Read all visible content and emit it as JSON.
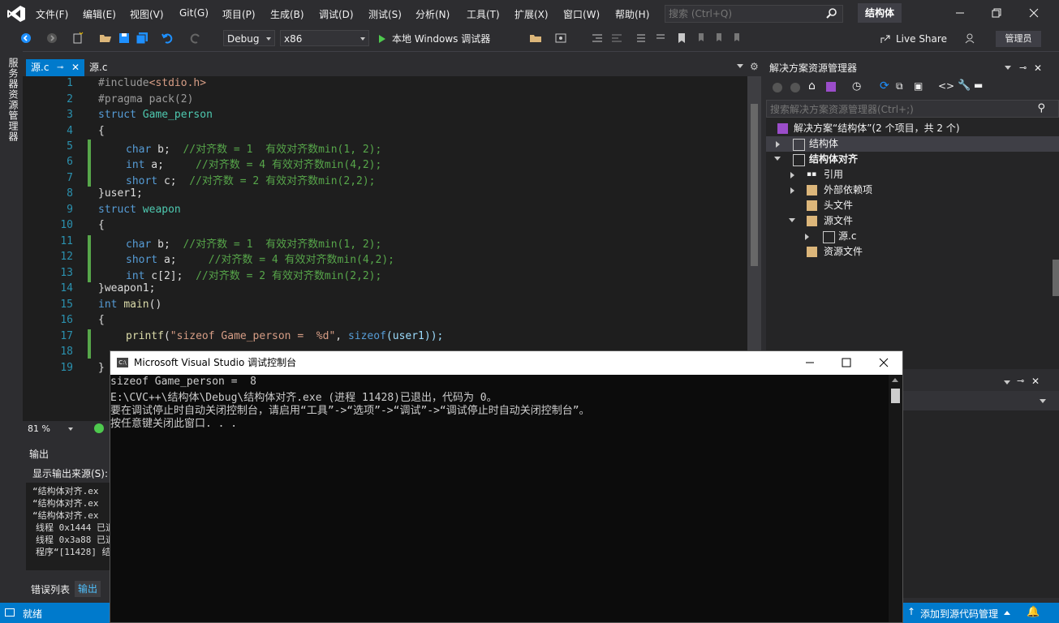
{
  "menu": {
    "items": [
      "文件(F)",
      "编辑(E)",
      "视图(V)",
      "Git(G)",
      "项目(P)",
      "生成(B)",
      "调试(D)",
      "测试(S)",
      "分析(N)",
      "工具(T)",
      "扩展(X)",
      "窗口(W)",
      "帮助(H)"
    ],
    "search_placeholder": "搜索 (Ctrl+Q)",
    "solution_name": "结构体"
  },
  "toolbar": {
    "config": "Debug",
    "platform": "x86",
    "run_label": "本地 Windows 调试器",
    "live_share": "Live Share",
    "admin": "管理员"
  },
  "left_strip": {
    "label": "服务器资源管理器"
  },
  "editor": {
    "tabs": [
      "源.c",
      "源.c"
    ],
    "zoom": "81 %",
    "lines": [
      {
        "n": "1"
      },
      {
        "n": "2"
      },
      {
        "n": "3"
      },
      {
        "n": "4"
      },
      {
        "n": "5"
      },
      {
        "n": "6"
      },
      {
        "n": "7"
      },
      {
        "n": "8"
      },
      {
        "n": "9"
      },
      {
        "n": "10"
      },
      {
        "n": "11"
      },
      {
        "n": "12"
      },
      {
        "n": "13"
      },
      {
        "n": "14"
      },
      {
        "n": "15"
      },
      {
        "n": "16"
      },
      {
        "n": "17"
      },
      {
        "n": "18"
      },
      {
        "n": "19"
      }
    ],
    "code": {
      "l1a": "#include",
      "l1b": "<stdio.h>",
      "l2": "#pragma pack(2)",
      "l3a": "struct",
      "l3b": "Game_person",
      "l4": "{",
      "l5a": "char",
      "l5b": " b;  ",
      "l5c": "//对齐数 = 1  有效对齐数min(1, 2);",
      "l6a": "int",
      "l6b": " a;     ",
      "l6c": "//对齐数 = 4 有效对齐数min(4,2);",
      "l7a": "short",
      "l7b": " c;  ",
      "l7c": "//对齐数 = 2 有效对齐数min(2,2);",
      "l8": "}user1;",
      "l9a": "struct",
      "l9b": "weapon",
      "l10": "{",
      "l11a": "char",
      "l11b": " b;  ",
      "l11c": "//对齐数 = 1  有效对齐数min(1, 2);",
      "l12a": "short",
      "l12b": " a;     ",
      "l12c": "//对齐数 = 4 有效对齐数min(4,2);",
      "l13a": "int",
      "l13b": " c[2];  ",
      "l13c": "//对齐数 = 2 有效对齐数min(2,2);",
      "l14": "}weapon1;",
      "l15a": "int",
      "l15b": "main",
      "l15c": "()",
      "l16": "{",
      "l17a": "printf",
      "l17b": "(",
      "l17c": "\"sizeof Game_person =  %d\"",
      "l17d": ", ",
      "l17e": "sizeof",
      "l17f": "(user1));",
      "l19": "}"
    }
  },
  "output": {
    "title": "输出",
    "source_label": "显示输出来源(S):",
    "lines": [
      "“结构体对齐.ex",
      "“结构体对齐.ex",
      "“结构体对齐.ex",
      "线程 0x1444 已退",
      "线程 0x3a88 已退",
      "程序“[11428] 结"
    ],
    "tabs": [
      "错误列表",
      "输出"
    ]
  },
  "solution_explorer": {
    "title": "解决方案资源管理器",
    "search_placeholder": "搜索解决方案资源管理器(Ctrl+;)",
    "root": "解决方案“结构体”(2 个项目，共 2 个)",
    "items": [
      "结构体",
      "结构体对齐",
      "引用",
      "外部依赖项",
      "头文件",
      "源文件",
      "源.c",
      "资源文件"
    ]
  },
  "console": {
    "title": "Microsoft Visual Studio 调试控制台",
    "lines": [
      "sizeof Game_person =  8",
      "E:\\CVC++\\结构体\\Debug\\结构体对齐.exe (进程 11428)已退出，代码为 0。",
      "要在调试停止时自动关闭控制台，请启用“工具”->“选项”->“调试”->“调试停止时自动关闭控制台”。",
      "按任意键关闭此窗口. . ."
    ]
  },
  "status": {
    "ready": "就绪",
    "source_control": "添加到源代码管理"
  }
}
